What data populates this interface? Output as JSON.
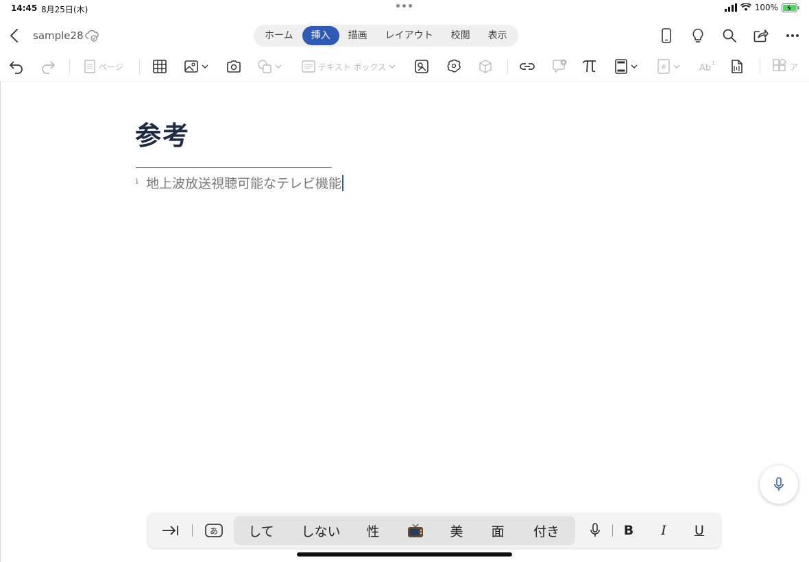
{
  "status": {
    "time": "14:45",
    "date": "8月25日(木)",
    "battery": "100%"
  },
  "header": {
    "doc_name": "sample28",
    "tabs": [
      {
        "label": "ホーム",
        "active": false
      },
      {
        "label": "挿入",
        "active": true
      },
      {
        "label": "描画",
        "active": false
      },
      {
        "label": "レイアウト",
        "active": false
      },
      {
        "label": "校閲",
        "active": false
      },
      {
        "label": "表示",
        "active": false
      }
    ]
  },
  "ribbon": {
    "page_label": "ページ",
    "textbox_label": "テキスト ボックス",
    "more_label": "ア"
  },
  "document": {
    "title": "参考",
    "footnote_marker": "i",
    "footnote_text": "地上波放送視聴可能なテレビ機能"
  },
  "keyboard": {
    "suggestions": [
      "して",
      "しない",
      "性",
      "📺",
      "美",
      "面",
      "付き"
    ],
    "bold_label": "B",
    "italic_label": "I",
    "underline_label": "U"
  },
  "colors": {
    "accent": "#2f5bb7",
    "title": "#1d2b45"
  }
}
